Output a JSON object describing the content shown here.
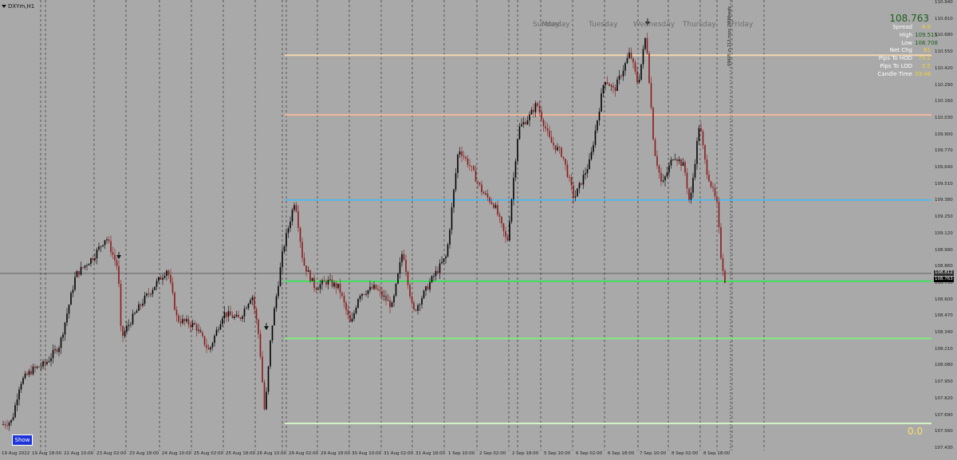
{
  "symbol": "DXYm,H1",
  "day_labels": [
    "Sunday",
    "Monday",
    "Tuesday",
    "Wednesday",
    "Thursday",
    "Friday"
  ],
  "info": {
    "price": "108.763",
    "rows": [
      {
        "label": "Spread",
        "value": "4.9",
        "color": "#f2d33a"
      },
      {
        "label": "High",
        "value": "109.515",
        "color": "#1b5e1b"
      },
      {
        "label": "Low",
        "value": "108.708",
        "color": "#1b5e1b"
      },
      {
        "label": "Net Chg",
        "value": "81",
        "color": "#f2d33a"
      },
      {
        "label": "Pips To HOD",
        "value": "75.2",
        "color": "#f2d33a"
      },
      {
        "label": "Pips To LOD",
        "value": "5.5",
        "color": "#f2d33a"
      },
      {
        "label": "Candle Time",
        "value": "33:46",
        "color": "#f2d33a"
      }
    ]
  },
  "show_button": "Show",
  "zero_label": "0.0",
  "vertical_note": "09405 in 213 mins\n1MINfeeds",
  "y_axis": {
    "ticks": [
      "110.940",
      "110.810",
      "110.680",
      "110.550",
      "110.420",
      "110.290",
      "110.160",
      "110.030",
      "109.900",
      "109.770",
      "109.640",
      "109.510",
      "109.380",
      "109.250",
      "109.120",
      "108.990",
      "108.860",
      "108.730",
      "108.600",
      "108.470",
      "108.340",
      "108.210",
      "108.080",
      "107.950",
      "107.820",
      "107.690",
      "107.560",
      "107.430"
    ],
    "current_price": "108.812",
    "bid_price": "108.763",
    "max": 110.94,
    "min": 107.43
  },
  "x_axis": {
    "ticks": [
      "19 Aug 2022",
      "19 Aug 18:00",
      "22 Aug 10:00",
      "23 Aug 02:00",
      "23 Aug 18:00",
      "24 Aug 10:00",
      "25 Aug 02:00",
      "25 Aug 18:00",
      "26 Aug 10:00",
      "29 Aug 02:00",
      "29 Aug 18:00",
      "30 Aug 10:00",
      "31 Aug 02:00",
      "31 Aug 18:00",
      "1 Sep 10:00",
      "2 Sep 02:00",
      "2 Sep 18:00",
      "5 Sep 10:00",
      "6 Sep 02:00",
      "6 Sep 18:00",
      "7 Sep 10:00",
      "8 Sep 02:00",
      "8 Sep 18:00"
    ]
  },
  "levels": [
    {
      "price": 110.53,
      "color": "#f3d6b0"
    },
    {
      "price": 110.06,
      "color": "#f1b89e"
    },
    {
      "price": 109.39,
      "color": "#56b7e8"
    },
    {
      "price": 108.75,
      "color": "#3ee05e"
    },
    {
      "price": 108.3,
      "color": "#7ff07c"
    },
    {
      "price": 107.63,
      "color": "#d6f5c8"
    }
  ],
  "chart_data": {
    "type": "candlestick",
    "symbol": "DXYm",
    "timeframe": "H1",
    "ylim": [
      107.43,
      110.94
    ],
    "x": [
      "19 Aug 2022",
      "19 Aug 18:00",
      "22 Aug 10:00",
      "23 Aug 02:00",
      "23 Aug 18:00",
      "24 Aug 10:00",
      "25 Aug 02:00",
      "25 Aug 18:00",
      "26 Aug 10:00",
      "29 Aug 02:00",
      "29 Aug 18:00",
      "30 Aug 10:00",
      "31 Aug 02:00",
      "31 Aug 18:00",
      "1 Sep 10:00",
      "2 Sep 02:00",
      "2 Sep 18:00",
      "5 Sep 10:00",
      "6 Sep 02:00",
      "6 Sep 18:00",
      "7 Sep 10:00",
      "8 Sep 02:00",
      "8 Sep 18:00"
    ],
    "close": [
      107.62,
      108.1,
      108.95,
      108.95,
      108.55,
      108.65,
      108.35,
      108.5,
      108.35,
      109.35,
      108.62,
      108.6,
      108.6,
      108.78,
      109.75,
      109.05,
      110.05,
      109.7,
      110.3,
      110.65,
      109.75,
      109.8,
      108.78
    ]
  },
  "colors": {
    "background": "#a9a9a9",
    "bull_candle": "#000000",
    "bear_candle": "#8b1a1a",
    "crosshair": "#3b3b3b"
  }
}
